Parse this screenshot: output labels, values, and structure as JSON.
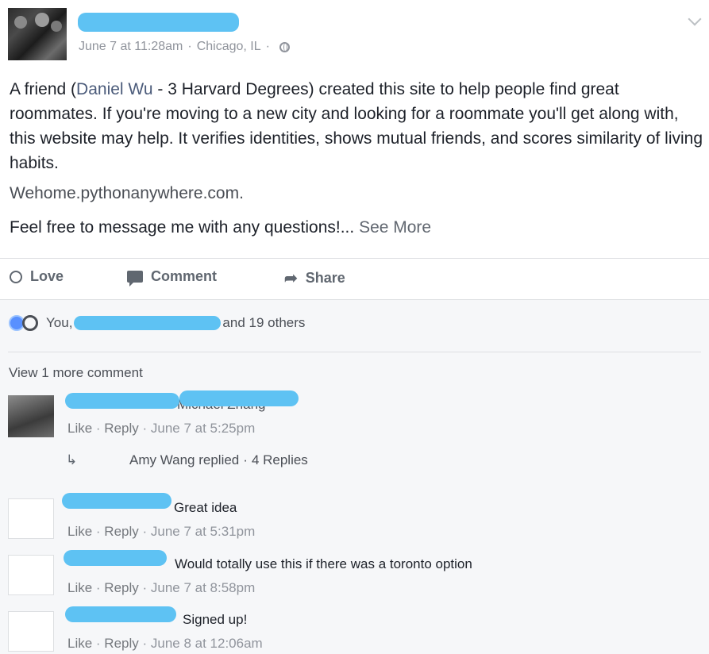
{
  "post": {
    "meta": {
      "time": "June 7 at 11:28am",
      "separator": "·",
      "location": "Chicago, IL",
      "separator2": "·",
      "icon": "globe-icon"
    },
    "text_before_name": "A friend (",
    "tagged_name": "Daniel Wu",
    "text_after_name": " - 3 Harvard Degrees) created this site to help people find great roommates. If you're moving to a new city and looking for a roommate you'll get along with, this website may help. It verifies identities, shows mutual friends, and scores similarity of living habits.",
    "link": "Wehome.pythonanywhere.com.",
    "text2": "Feel free to message me with any questions!...",
    "see_more": "See More"
  },
  "actions": {
    "love": "Love",
    "comment": "Comment",
    "share": "Share"
  },
  "reactions": {
    "prefix": "You,",
    "suffix": "and 19 others"
  },
  "view_more": "View 1 more comment",
  "comments": [
    {
      "name_visible": "Michael Zhang",
      "text": "",
      "like": "Like",
      "reply": "Reply",
      "time": "June 7 at 5:25pm"
    },
    {
      "name_visible": "",
      "text": "Great idea",
      "like": "Like",
      "reply": "Reply",
      "time": "June 7 at 5:31pm"
    },
    {
      "name_visible": "",
      "text": "Would totally use this if there was a toronto option",
      "like": "Like",
      "reply": "Reply",
      "time": "June 7 at 8:58pm"
    },
    {
      "name_visible": "",
      "text": "Signed up!",
      "like": "Like",
      "reply": "Reply",
      "time": "June 8 at 12:06am"
    }
  ],
  "replies": {
    "text": "Amy Wang replied",
    "sep": "·",
    "count": "4 Replies"
  },
  "colors": {
    "redaction": "#5ec2f3",
    "link": "#365899",
    "meta": "#90949c"
  }
}
